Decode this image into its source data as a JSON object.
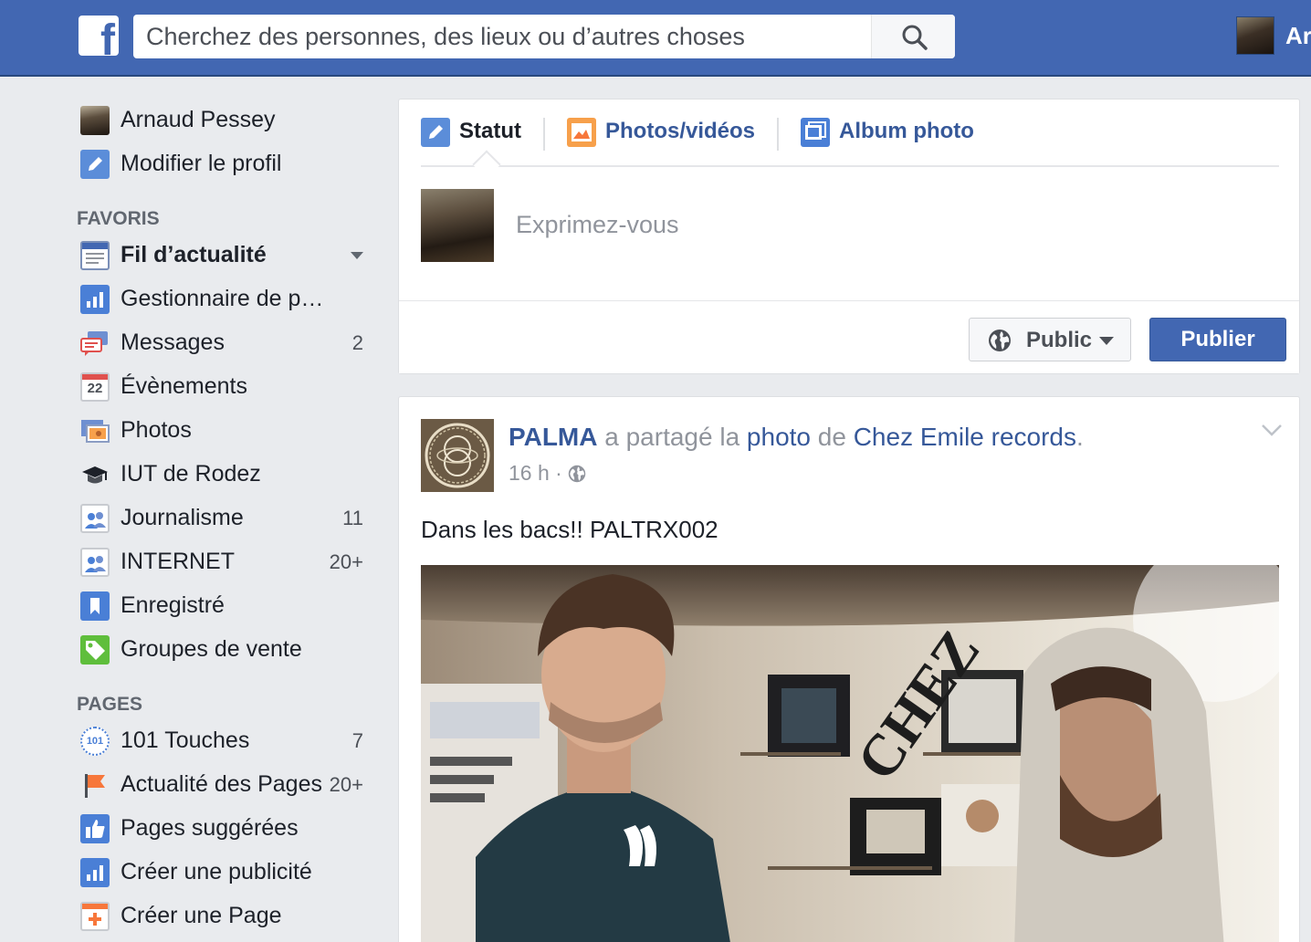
{
  "header": {
    "logo": "f",
    "search_placeholder": "Cherchez des personnes, des lieux ou d’autres choses",
    "user_name": "Ar"
  },
  "sidebar": {
    "profile": {
      "name": "Arnaud Pessey",
      "edit": "Modifier le profil"
    },
    "favorites_title": "FAVORIS",
    "favorites": [
      {
        "label": "Fil d’actualité",
        "icon": "newsfeed-icon",
        "count": ""
      },
      {
        "label": "Gestionnaire de publicités",
        "icon": "ads-manager-icon",
        "count": ""
      },
      {
        "label": "Messages",
        "icon": "messages-icon",
        "count": "2"
      },
      {
        "label": "Évènements",
        "icon": "calendar-icon",
        "count": "",
        "calendar_day": "22"
      },
      {
        "label": "Photos",
        "icon": "photos-icon",
        "count": ""
      },
      {
        "label": "IUT de Rodez",
        "icon": "graduation-cap-icon",
        "count": ""
      },
      {
        "label": "Journalisme",
        "icon": "group-icon",
        "count": "11"
      },
      {
        "label": "INTERNET",
        "icon": "group-icon",
        "count": "20+"
      },
      {
        "label": "Enregistré",
        "icon": "bookmark-icon",
        "count": ""
      },
      {
        "label": "Groupes de vente",
        "icon": "sale-tag-icon",
        "count": ""
      }
    ],
    "pages_title": "PAGES",
    "pages": [
      {
        "label": "101 Touches",
        "icon": "page-logo-icon",
        "count": "7"
      },
      {
        "label": "Actualité des Pages",
        "icon": "flag-icon",
        "count": "20+"
      },
      {
        "label": "Pages suggérées",
        "icon": "thumbs-up-icon",
        "count": ""
      },
      {
        "label": "Créer une publicité",
        "icon": "ads-chart-icon",
        "count": ""
      },
      {
        "label": "Créer une Page",
        "icon": "create-page-icon",
        "count": ""
      }
    ]
  },
  "composer": {
    "tabs": [
      {
        "label": "Statut",
        "icon": "pencil-icon"
      },
      {
        "label": "Photos/vidéos",
        "icon": "photo-icon"
      },
      {
        "label": "Album photo",
        "icon": "album-icon"
      }
    ],
    "placeholder": "Exprimez-vous",
    "privacy": "Public",
    "publish": "Publier"
  },
  "post": {
    "author": "PALMA",
    "action": " a partagé la ",
    "object": "photo",
    "of": " de ",
    "source": "Chez Emile records",
    "period": ".",
    "time": "16 h",
    "separator": " · ",
    "text": "Dans les bacs!! PALTRX002"
  },
  "colors": {
    "brand": "#4267b2",
    "link": "#365899",
    "background": "#e9ebee"
  }
}
